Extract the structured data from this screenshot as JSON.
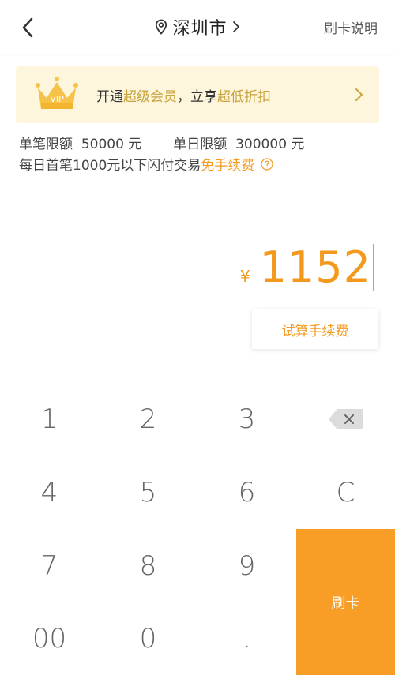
{
  "header": {
    "city": "深圳市",
    "help_label": "刷卡说明"
  },
  "vip_banner": {
    "badge_text": "VIP",
    "part1": "开通",
    "highlight1": "超级会员",
    "part2": "，立享",
    "highlight2": "超低折扣"
  },
  "limits": {
    "single_label": "单笔限额",
    "single_value": "50000 元",
    "daily_label": "单日限额",
    "daily_value": "300000 元",
    "free_text": "每日首笔1000元以下闪付交易",
    "free_highlight": "免手续费"
  },
  "amount": {
    "currency": "¥",
    "value": "1152"
  },
  "fee_button_label": "试算手续费",
  "keypad": {
    "keys": [
      "1",
      "2",
      "3",
      "4",
      "5",
      "6",
      "7",
      "8",
      "9",
      "00",
      "0",
      "."
    ],
    "clear_label": "C",
    "submit_label": "刷卡"
  },
  "colors": {
    "accent": "#f89d25",
    "gold": "#c9a43e",
    "banner_bg": "#fdf6dd"
  }
}
